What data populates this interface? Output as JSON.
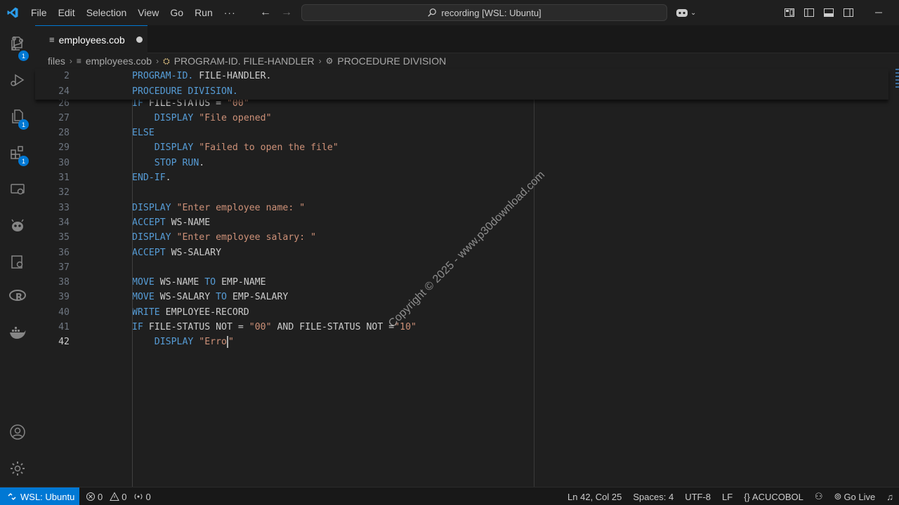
{
  "menu": [
    "File",
    "Edit",
    "Selection",
    "View",
    "Go",
    "Run",
    "···"
  ],
  "command_center": "recording [WSL: Ubuntu]",
  "activity_badges": {
    "explorer": "1",
    "extensions": "1"
  },
  "tab": {
    "label": "employees.cob"
  },
  "breadcrumbs": [
    "files",
    "employees.cob",
    "PROGRAM-ID. FILE-HANDLER",
    "PROCEDURE DIVISION"
  ],
  "sticky_lines": [
    {
      "num": "2",
      "tokens": [
        {
          "t": "PROGRAM-ID.",
          "c": "kw"
        },
        {
          "t": " FILE-HANDLER.",
          "c": "id"
        }
      ]
    },
    {
      "num": "24",
      "tokens": [
        {
          "t": "PROCEDURE DIVISION.",
          "c": "kw"
        }
      ]
    }
  ],
  "lines": [
    {
      "num": "26",
      "tokens": [
        {
          "t": "IF",
          "c": "kw"
        },
        {
          "t": " FILE-STATUS = ",
          "c": "id"
        },
        {
          "t": "\"00\"",
          "c": "str"
        }
      ]
    },
    {
      "num": "27",
      "tokens": [
        {
          "t": "    DISPLAY",
          "c": "kw"
        },
        {
          "t": " ",
          "c": "id"
        },
        {
          "t": "\"File opened\"",
          "c": "str"
        }
      ]
    },
    {
      "num": "28",
      "tokens": [
        {
          "t": "ELSE",
          "c": "kw"
        }
      ]
    },
    {
      "num": "29",
      "tokens": [
        {
          "t": "    DISPLAY",
          "c": "kw"
        },
        {
          "t": " ",
          "c": "id"
        },
        {
          "t": "\"Failed to open the file\"",
          "c": "str"
        }
      ]
    },
    {
      "num": "30",
      "tokens": [
        {
          "t": "    STOP RUN",
          "c": "kw"
        },
        {
          "t": ".",
          "c": "id"
        }
      ]
    },
    {
      "num": "31",
      "tokens": [
        {
          "t": "END-IF",
          "c": "kw"
        },
        {
          "t": ".",
          "c": "id"
        }
      ]
    },
    {
      "num": "32",
      "tokens": []
    },
    {
      "num": "33",
      "tokens": [
        {
          "t": "DISPLAY",
          "c": "kw"
        },
        {
          "t": " ",
          "c": "id"
        },
        {
          "t": "\"Enter employee name: \"",
          "c": "str"
        }
      ]
    },
    {
      "num": "34",
      "tokens": [
        {
          "t": "ACCEPT",
          "c": "kw"
        },
        {
          "t": " WS-NAME",
          "c": "id"
        }
      ]
    },
    {
      "num": "35",
      "tokens": [
        {
          "t": "DISPLAY",
          "c": "kw"
        },
        {
          "t": " ",
          "c": "id"
        },
        {
          "t": "\"Enter employee salary: \"",
          "c": "str"
        }
      ]
    },
    {
      "num": "36",
      "tokens": [
        {
          "t": "ACCEPT",
          "c": "kw"
        },
        {
          "t": " WS-SALARY",
          "c": "id"
        }
      ]
    },
    {
      "num": "37",
      "tokens": []
    },
    {
      "num": "38",
      "tokens": [
        {
          "t": "MOVE",
          "c": "kw"
        },
        {
          "t": " WS-NAME ",
          "c": "id"
        },
        {
          "t": "TO",
          "c": "kw"
        },
        {
          "t": " EMP-NAME",
          "c": "id"
        }
      ]
    },
    {
      "num": "39",
      "tokens": [
        {
          "t": "MOVE",
          "c": "kw"
        },
        {
          "t": " WS-SALARY ",
          "c": "id"
        },
        {
          "t": "TO",
          "c": "kw"
        },
        {
          "t": " EMP-SALARY",
          "c": "id"
        }
      ]
    },
    {
      "num": "40",
      "tokens": [
        {
          "t": "WRITE",
          "c": "kw"
        },
        {
          "t": " EMPLOYEE-RECORD",
          "c": "id"
        }
      ]
    },
    {
      "num": "41",
      "tokens": [
        {
          "t": "IF",
          "c": "kw"
        },
        {
          "t": " FILE-STATUS NOT = ",
          "c": "id"
        },
        {
          "t": "\"00\"",
          "c": "str"
        },
        {
          "t": " AND FILE-STATUS NOT =",
          "c": "id"
        },
        {
          "t": "\"10\"",
          "c": "str"
        }
      ]
    },
    {
      "num": "42",
      "active": true,
      "tokens": [
        {
          "t": "    DISPLAY",
          "c": "kw"
        },
        {
          "t": " ",
          "c": "id"
        },
        {
          "t": "\"Erro",
          "c": "str"
        },
        {
          "t": "CURSOR",
          "c": "cursor"
        },
        {
          "t": "\"",
          "c": "str"
        }
      ]
    }
  ],
  "watermark": "Copyright © 2025 - www.p30download.com",
  "status": {
    "remote": "WSL: Ubuntu",
    "errors": "0",
    "warnings": "0",
    "ports": "0",
    "position": "Ln 42, Col 25",
    "spaces": "Spaces: 4",
    "encoding": "UTF-8",
    "eol": "LF",
    "language": "ACUCOBOL",
    "live_server": "Go Live"
  },
  "colors": {
    "accent": "#0078d4",
    "keyword": "#569cd6",
    "string": "#ce9178"
  }
}
